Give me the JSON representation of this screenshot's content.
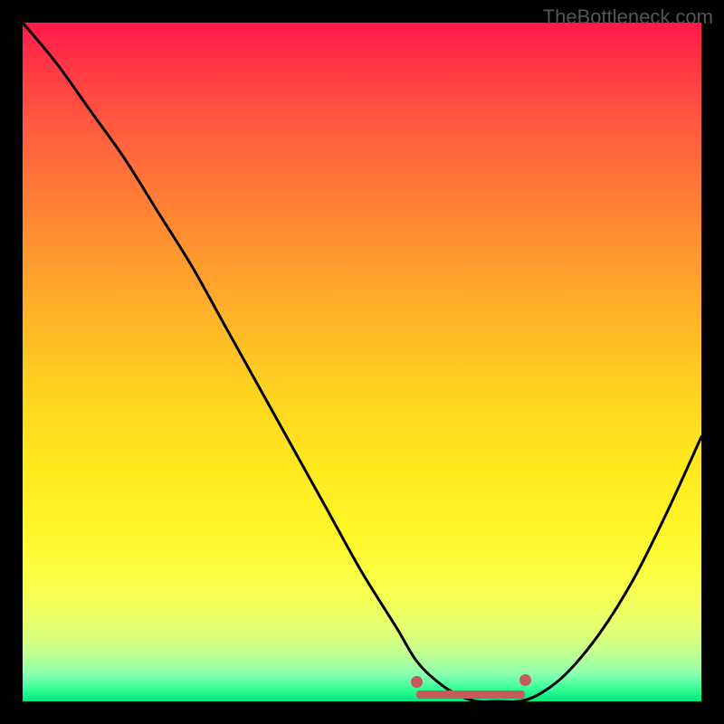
{
  "watermark": "TheBottleneck.com",
  "chart_data": {
    "type": "line",
    "title": "",
    "xlabel": "",
    "ylabel": "",
    "xlim": [
      0,
      100
    ],
    "ylim": [
      0,
      100
    ],
    "series": [
      {
        "name": "bottleneck-curve",
        "x": [
          0,
          5,
          10,
          15,
          20,
          25,
          30,
          35,
          40,
          45,
          50,
          55,
          58,
          61,
          64,
          67,
          70,
          73,
          76,
          80,
          85,
          90,
          95,
          100
        ],
        "y": [
          100,
          94,
          87,
          80,
          72,
          64,
          55,
          46,
          37,
          28,
          19,
          11,
          6,
          3,
          1,
          0,
          0,
          0,
          1,
          4,
          10,
          18,
          28,
          39
        ]
      }
    ],
    "optimal_range": {
      "start": 58,
      "end": 74
    },
    "background_gradient": {
      "top": "#ff1a4a",
      "mid": "#ffe81e",
      "bottom": "#00e67a"
    }
  }
}
